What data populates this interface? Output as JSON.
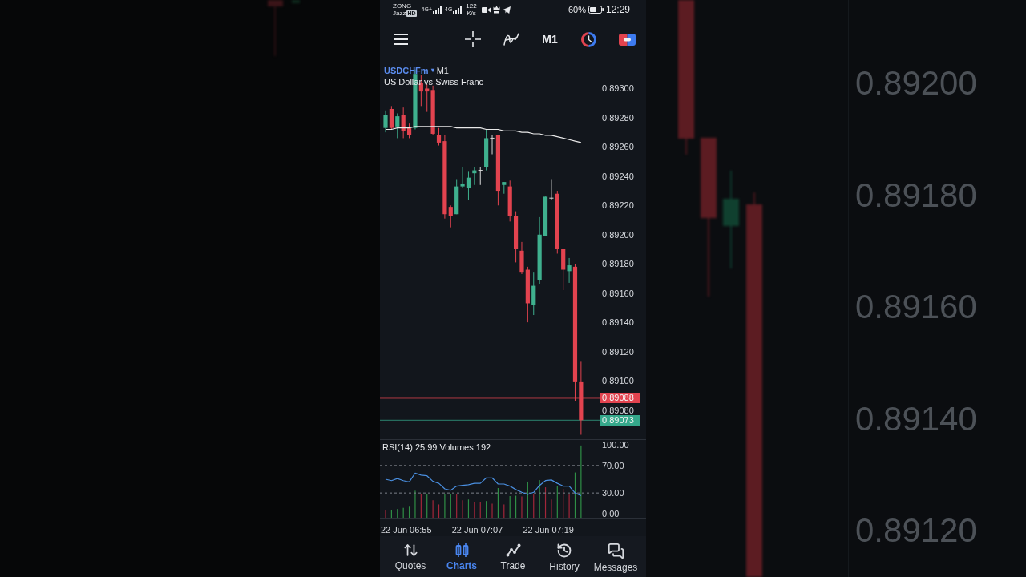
{
  "backdrop": {
    "price_labels": [
      "0.89200",
      "0.89180",
      "0.89160",
      "0.89140",
      "0.89120"
    ]
  },
  "status_bar": {
    "carrier_top": "ZONG",
    "carrier_bottom": "Jazz",
    "hd_badge": "HD",
    "network_types": [
      "4G+",
      "4G"
    ],
    "speed_value": "122",
    "speed_unit": "K/s",
    "battery": "60%",
    "time": "12:29"
  },
  "toolbar": {
    "timeframe": "M1"
  },
  "chart": {
    "symbol": "USDCHFm",
    "symbol_caret": "▾",
    "timeframe": "M1",
    "description": "US Dollar vs Swiss Franc",
    "chart_data": [
      {
        "type": "candlestick",
        "tick_labels": "y",
        "ylim": [
          0.8906,
          0.8932
        ],
        "yticks": [
          {
            "value": 0.893,
            "label": "0.89300"
          },
          {
            "value": 0.8928,
            "label": "0.89280"
          },
          {
            "value": 0.8926,
            "label": "0.89260"
          },
          {
            "value": 0.8924,
            "label": "0.89240"
          },
          {
            "value": 0.8922,
            "label": "0.89220"
          },
          {
            "value": 0.892,
            "label": "0.89200"
          },
          {
            "value": 0.8918,
            "label": "0.89180"
          },
          {
            "value": 0.8916,
            "label": "0.89160"
          },
          {
            "value": 0.8914,
            "label": "0.89140"
          },
          {
            "value": 0.8912,
            "label": "0.89120"
          },
          {
            "value": 0.891,
            "label": "0.89100"
          },
          {
            "value": 0.8908,
            "label": "0.89080"
          }
        ],
        "ref_lines": [
          {
            "axis": "y",
            "value": 0.89088,
            "label": "0.89088",
            "color": "#e2434f"
          },
          {
            "axis": "y",
            "value": 0.89073,
            "label": "0.89073",
            "color": "#35a88b"
          }
        ],
        "series": [
          {
            "type": "candlestick",
            "ohlc": [
              [
                0.89273,
                0.89285,
                0.8927,
                0.89282
              ],
              [
                0.89286,
                0.89288,
                0.89272,
                0.89273
              ],
              [
                0.89274,
                0.89283,
                0.89266,
                0.89281
              ],
              [
                0.89282,
                0.89287,
                0.89266,
                0.89271
              ],
              [
                0.89273,
                0.89276,
                0.89266,
                0.89268
              ],
              [
                0.89273,
                0.89313,
                0.89272,
                0.8931
              ],
              [
                0.89304,
                0.89309,
                0.89288,
                0.89298
              ],
              [
                0.893,
                0.89303,
                0.89284,
                0.89298
              ],
              [
                0.89299,
                0.89302,
                0.89268,
                0.89269
              ],
              [
                0.89268,
                0.89273,
                0.89261,
                0.89263
              ],
              [
                0.89264,
                0.89268,
                0.89211,
                0.89214
              ],
              [
                0.89219,
                0.8922,
                0.89205,
                0.89213
              ],
              [
                0.89214,
                0.89238,
                0.89214,
                0.89233
              ],
              [
                0.89233,
                0.89246,
                0.89232,
                0.89235
              ],
              [
                0.89232,
                0.89243,
                0.89224,
                0.89239
              ],
              [
                0.89242,
                0.89246,
                0.89234,
                0.89244
              ],
              [
                0.89244,
                0.89246,
                0.89234,
                0.89244
              ],
              [
                0.89246,
                0.89272,
                0.89244,
                0.89266
              ],
              [
                0.89266,
                0.89268,
                0.89255,
                0.89266
              ],
              [
                0.89268,
                0.89268,
                0.8922,
                0.8923
              ],
              [
                0.89234,
                0.89236,
                0.89228,
                0.89236
              ],
              [
                0.89233,
                0.89237,
                0.89209,
                0.89213
              ],
              [
                0.89213,
                0.89216,
                0.89181,
                0.8919
              ],
              [
                0.89189,
                0.89195,
                0.89173,
                0.89174
              ],
              [
                0.89176,
                0.89178,
                0.8914,
                0.89153
              ],
              [
                0.89152,
                0.89174,
                0.89145,
                0.89165
              ],
              [
                0.89169,
                0.89212,
                0.89166,
                0.892
              ],
              [
                0.89199,
                0.89226,
                0.89199,
                0.89226
              ],
              [
                0.89225,
                0.89238,
                0.89224,
                0.89225
              ],
              [
                0.89228,
                0.8923,
                0.89187,
                0.8919
              ],
              [
                0.8919,
                0.8919,
                0.89162,
                0.89176
              ],
              [
                0.89175,
                0.89184,
                0.89167,
                0.89179
              ],
              [
                0.89178,
                0.8918,
                0.89086,
                0.89099
              ],
              [
                0.89099,
                0.89113,
                0.89063,
                0.89073
              ]
            ]
          },
          {
            "type": "line",
            "color": "#e8e8e8",
            "values": [
              0.89272,
              0.89272,
              0.89273,
              0.89273,
              0.89273,
              0.89274,
              0.89274,
              0.89274,
              0.89274,
              0.89274,
              0.89274,
              0.89274,
              0.89273,
              0.89273,
              0.89273,
              0.89273,
              0.89273,
              0.89272,
              0.89272,
              0.89272,
              0.89271,
              0.89271,
              0.89271,
              0.8927,
              0.8927,
              0.89269,
              0.89269,
              0.89268,
              0.89268,
              0.89267,
              0.89266,
              0.89265,
              0.89264,
              0.89263
            ]
          }
        ]
      },
      {
        "type": "line",
        "title": "RSI(14) 25.99 Volumes 192",
        "ylim": [
          -8.33,
          108.33
        ],
        "yticks": [
          {
            "value": 100,
            "label": "100.00"
          },
          {
            "value": 70,
            "label": "70.00"
          },
          {
            "value": 30,
            "label": "30.00"
          },
          {
            "value": 0,
            "label": "0.00"
          }
        ],
        "ref_lines": [
          {
            "axis": "y",
            "value": 70,
            "color": "#7d828a",
            "line_style": "dashed"
          },
          {
            "axis": "y",
            "value": 30,
            "color": "#7d828a",
            "line_style": "dashed"
          }
        ],
        "color": "#4a8fe0",
        "values": [
          50,
          48,
          51,
          48,
          46,
          59,
          56,
          55,
          47,
          44,
          36,
          34,
          40,
          41,
          42,
          44,
          44,
          52,
          52,
          43,
          43,
          40,
          35,
          31,
          28,
          31,
          41,
          48,
          49,
          44,
          40,
          40,
          30,
          26
        ]
      }
    ]
  },
  "time_axis": {
    "labels": [
      "22 Jun 06:55",
      "22 Jun 07:07",
      "22 Jun 07:19"
    ]
  },
  "nav": [
    {
      "label": "Quotes",
      "selected": false
    },
    {
      "label": "Charts",
      "selected": true
    },
    {
      "label": "Trade",
      "selected": false
    },
    {
      "label": "History",
      "selected": false
    },
    {
      "label": "Messages",
      "selected": false
    }
  ]
}
